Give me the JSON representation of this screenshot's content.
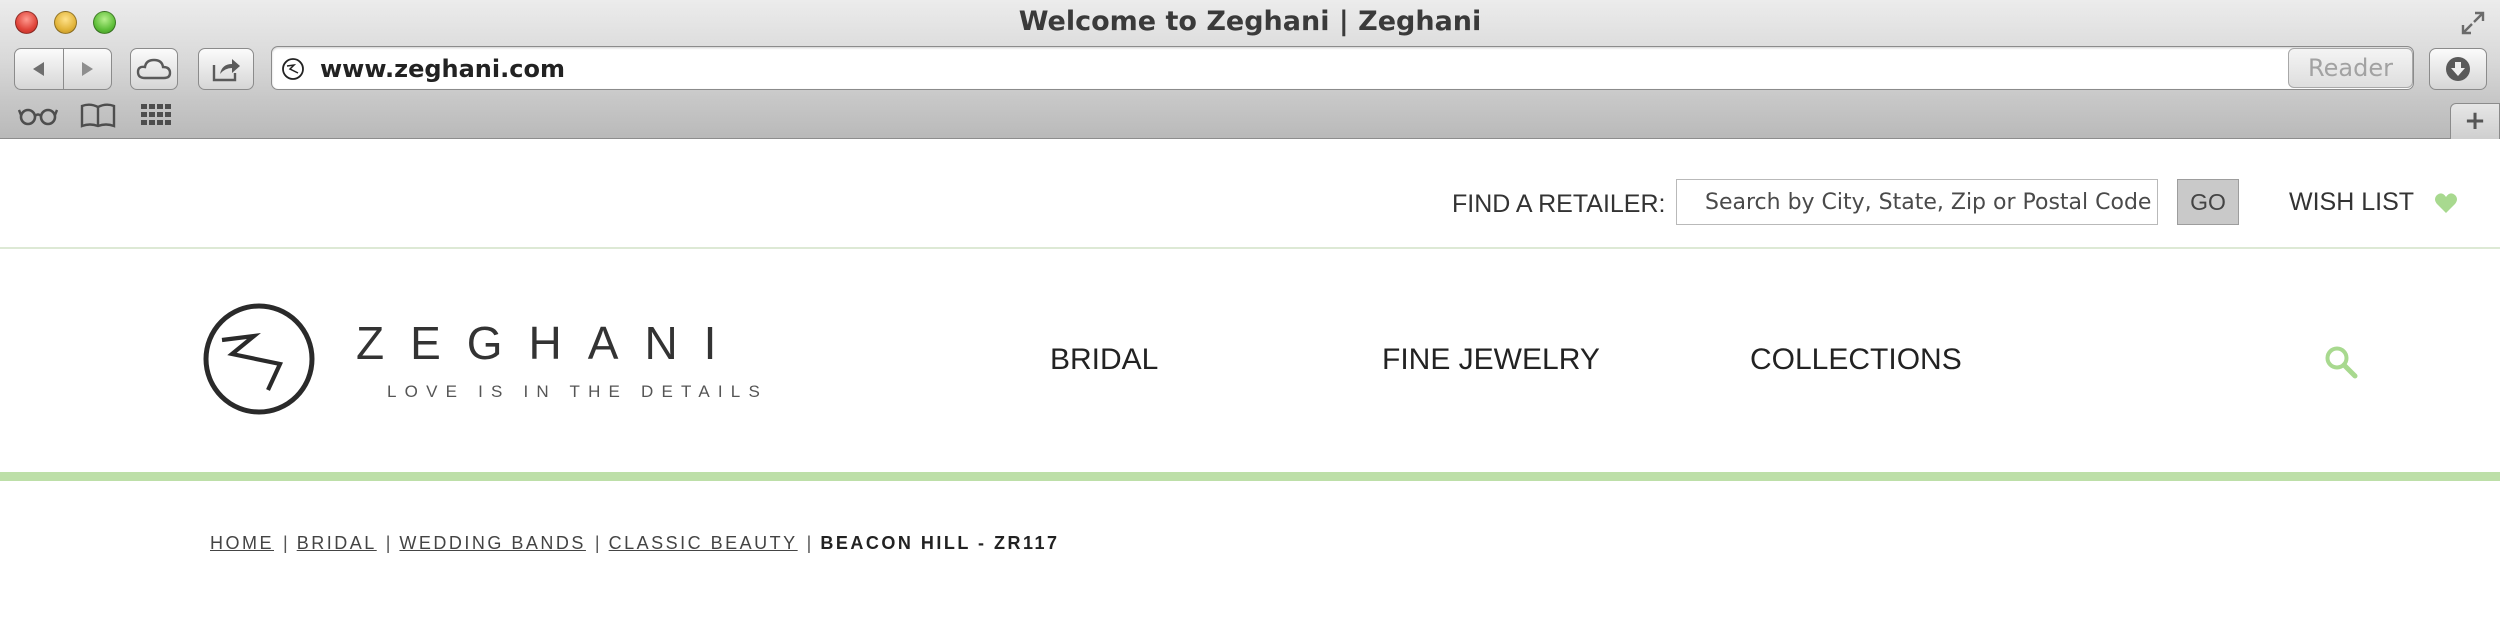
{
  "browser": {
    "window_title": "Welcome to Zeghani | Zeghani",
    "url": "www.zeghani.com",
    "reader_label": "Reader",
    "new_tab_label": "+"
  },
  "header": {
    "retailer_label": "FIND A RETAILER:",
    "search_placeholder": "Search by City, State, Zip or Postal Code",
    "go_label": "GO",
    "wishlist_label": "WISH LIST"
  },
  "logo": {
    "wordmark": "ZEGHANI",
    "tagline": "LOVE IS IN THE DETAILS"
  },
  "nav": {
    "items": [
      {
        "label": "BRIDAL"
      },
      {
        "label": "FINE JEWELRY"
      },
      {
        "label": "COLLECTIONS"
      }
    ]
  },
  "breadcrumb": {
    "links": [
      {
        "label": "HOME"
      },
      {
        "label": "BRIDAL"
      },
      {
        "label": "WEDDING BANDS"
      },
      {
        "label": "CLASSIC BEAUTY"
      }
    ],
    "separator": "|",
    "current": "BEACON HILL - ZR117"
  },
  "colors": {
    "accent_green": "#bddfa8",
    "icon_green": "#a8d98f",
    "text_dark": "#222222"
  },
  "icons": {
    "heart": "heart-icon",
    "search": "search-icon",
    "back": "back-arrow-icon",
    "forward": "forward-arrow-icon",
    "cloud": "cloud-icon",
    "share": "share-icon",
    "reload": "reload-icon",
    "download": "download-icon",
    "reading_list": "reading-list-icon",
    "bookmarks": "bookmarks-icon",
    "top_sites": "top-sites-icon"
  }
}
